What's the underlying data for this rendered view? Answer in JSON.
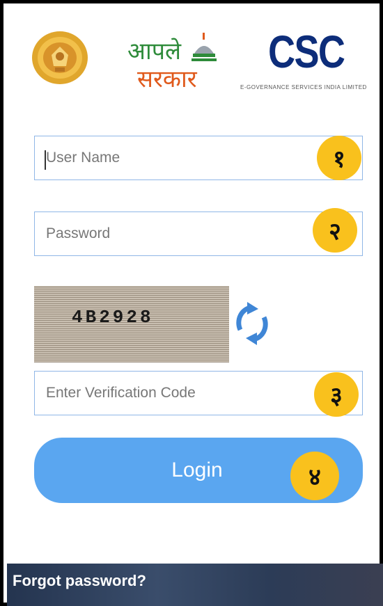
{
  "header": {
    "emblem_name": "maharashtra-emblem",
    "aaple_line1": "आपले",
    "aaple_line2": "सरकार",
    "csc_title": "CSC",
    "csc_subtitle": "E-GOVERNANCE SERVICES INDIA LIMITED"
  },
  "form": {
    "username_placeholder": "User Name",
    "password_placeholder": "Password",
    "captcha_text": "4B2928",
    "verification_placeholder": "Enter Verification Code",
    "login_label": "Login"
  },
  "badges": {
    "b1": "१",
    "b2": "२",
    "b3": "३",
    "b4": "४"
  },
  "footer": {
    "forgot_label": "Forgot password?"
  },
  "colors": {
    "badge": "#f9c11d",
    "login_button": "#5aa6f0",
    "input_border": "#8fb6e6",
    "csc_blue": "#0d2d7a",
    "refresh_icon": "#3f86d6"
  }
}
